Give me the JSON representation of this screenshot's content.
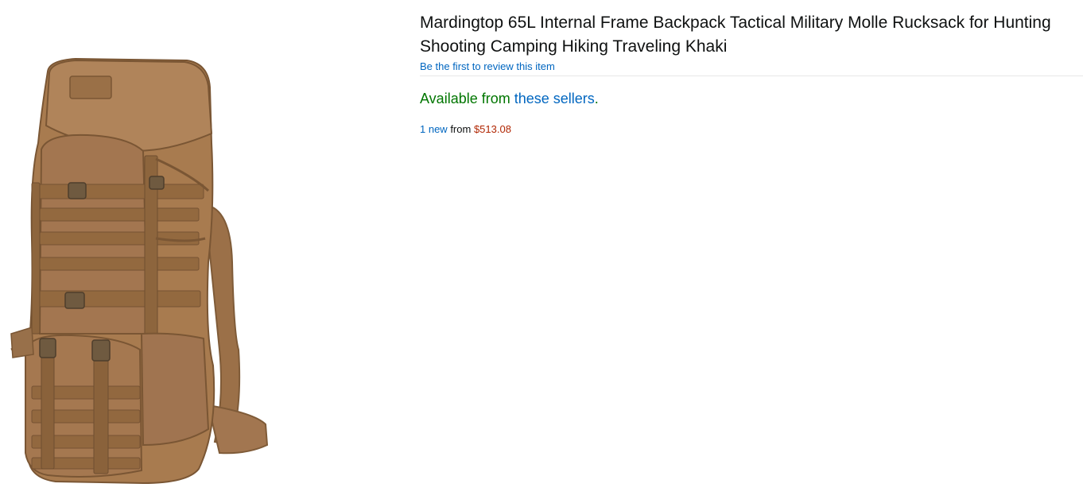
{
  "product": {
    "title": "Mardingtop 65L Internal Frame Backpack Tactical Military Molle Rucksack for Hunting Shooting Camping Hiking Traveling Khaki",
    "review_link": "Be the first to review this item",
    "image_alt": "khaki tactical backpack"
  },
  "availability": {
    "prefix": "Available from ",
    "link": "these sellers",
    "suffix": "."
  },
  "offers": {
    "count_link": "1 new",
    "from_text": " from ",
    "price": "$513.08"
  },
  "colors": {
    "title": "#0f1111",
    "link": "#0066c0",
    "available": "#007600",
    "price": "#b12704",
    "backpack_main": "#a87b4f",
    "backpack_dark": "#8c6540"
  }
}
